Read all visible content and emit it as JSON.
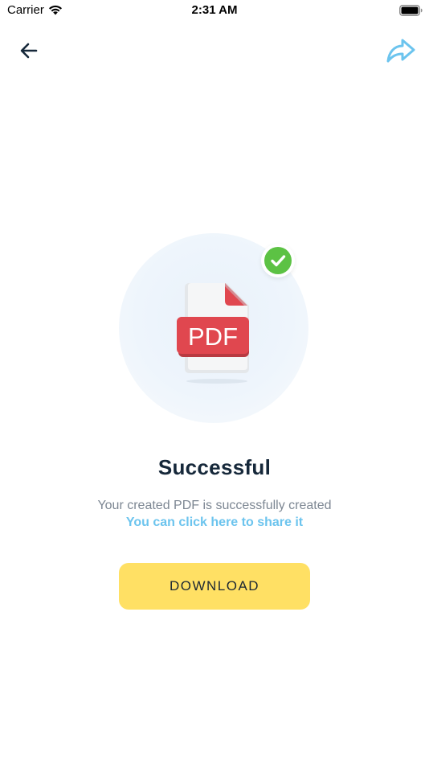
{
  "status_bar": {
    "carrier": "Carrier",
    "time": "2:31 AM",
    "icons": [
      "wifi-icon",
      "battery-icon"
    ]
  },
  "nav": {
    "back_icon": "arrow-left-icon",
    "share_icon": "share-forward-icon"
  },
  "illustration": {
    "file_label": "PDF",
    "badge_icon": "check-icon",
    "colors": {
      "pdf_red": "#e0474f",
      "check_green": "#5cc244",
      "circle_bg": "#eef5fc"
    }
  },
  "content": {
    "title": "Successful",
    "subtitle": "Your created PDF is successfully created",
    "share_link": "You can click here to share it"
  },
  "actions": {
    "download_label": "DOWNLOAD"
  },
  "colors": {
    "title": "#16283a",
    "link": "#6cc4ee",
    "button_bg": "#ffe064",
    "share_icon": "#6cc4ee"
  }
}
